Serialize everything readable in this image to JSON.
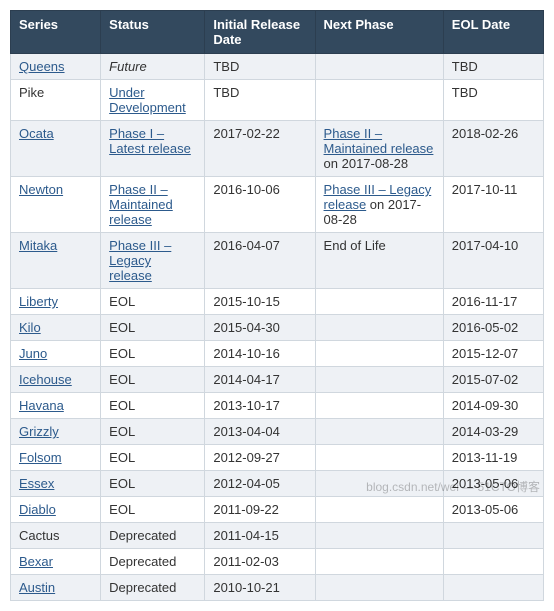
{
  "headers": {
    "series": "Series",
    "status": "Status",
    "initial": "Initial Release Date",
    "next": "Next Phase",
    "eol": "EOL Date"
  },
  "rows": [
    {
      "series": {
        "text": "Queens",
        "link": true
      },
      "status": {
        "text": "Future",
        "link": false,
        "italic": true
      },
      "initial": "TBD",
      "next": {
        "text": "",
        "link": "",
        "suffix": ""
      },
      "eol": "TBD"
    },
    {
      "series": {
        "text": "Pike",
        "link": false
      },
      "status": {
        "text": "Under Development",
        "link": true
      },
      "initial": "TBD",
      "next": {
        "text": "",
        "link": "",
        "suffix": ""
      },
      "eol": "TBD"
    },
    {
      "series": {
        "text": "Ocata",
        "link": true
      },
      "status": {
        "text": "Phase I – Latest release",
        "link": true
      },
      "initial": "2017-02-22",
      "next": {
        "link": "Phase II – Maintained release",
        "suffix": " on 2017-08-28"
      },
      "eol": "2018-02-26"
    },
    {
      "series": {
        "text": "Newton",
        "link": true
      },
      "status": {
        "text": "Phase II – Maintained release",
        "link": true
      },
      "initial": "2016-10-06",
      "next": {
        "link": "Phase III – Legacy release",
        "suffix": " on 2017-08-28"
      },
      "eol": "2017-10-11"
    },
    {
      "series": {
        "text": "Mitaka",
        "link": true
      },
      "status": {
        "text": "Phase III – Legacy release",
        "link": true
      },
      "initial": "2016-04-07",
      "next": {
        "text": "End of Life",
        "link": "",
        "suffix": ""
      },
      "eol": "2017-04-10"
    },
    {
      "series": {
        "text": "Liberty",
        "link": true
      },
      "status": {
        "text": "EOL",
        "link": false
      },
      "initial": "2015-10-15",
      "next": {
        "text": "",
        "link": "",
        "suffix": ""
      },
      "eol": "2016-11-17"
    },
    {
      "series": {
        "text": "Kilo",
        "link": true
      },
      "status": {
        "text": "EOL",
        "link": false
      },
      "initial": "2015-04-30",
      "next": {
        "text": "",
        "link": "",
        "suffix": ""
      },
      "eol": "2016-05-02"
    },
    {
      "series": {
        "text": "Juno",
        "link": true
      },
      "status": {
        "text": "EOL",
        "link": false
      },
      "initial": "2014-10-16",
      "next": {
        "text": "",
        "link": "",
        "suffix": ""
      },
      "eol": "2015-12-07"
    },
    {
      "series": {
        "text": "Icehouse",
        "link": true
      },
      "status": {
        "text": "EOL",
        "link": false
      },
      "initial": "2014-04-17",
      "next": {
        "text": "",
        "link": "",
        "suffix": ""
      },
      "eol": "2015-07-02"
    },
    {
      "series": {
        "text": "Havana",
        "link": true
      },
      "status": {
        "text": "EOL",
        "link": false
      },
      "initial": "2013-10-17",
      "next": {
        "text": "",
        "link": "",
        "suffix": ""
      },
      "eol": "2014-09-30"
    },
    {
      "series": {
        "text": "Grizzly",
        "link": true
      },
      "status": {
        "text": "EOL",
        "link": false
      },
      "initial": "2013-04-04",
      "next": {
        "text": "",
        "link": "",
        "suffix": ""
      },
      "eol": "2014-03-29"
    },
    {
      "series": {
        "text": "Folsom",
        "link": true
      },
      "status": {
        "text": "EOL",
        "link": false
      },
      "initial": "2012-09-27",
      "next": {
        "text": "",
        "link": "",
        "suffix": ""
      },
      "eol": "2013-11-19"
    },
    {
      "series": {
        "text": "Essex",
        "link": true
      },
      "status": {
        "text": "EOL",
        "link": false
      },
      "initial": "2012-04-05",
      "next": {
        "text": "",
        "link": "",
        "suffix": ""
      },
      "eol": "2013-05-06"
    },
    {
      "series": {
        "text": "Diablo",
        "link": true
      },
      "status": {
        "text": "EOL",
        "link": false
      },
      "initial": "2011-09-22",
      "next": {
        "text": "",
        "link": "",
        "suffix": ""
      },
      "eol": "2013-05-06"
    },
    {
      "series": {
        "text": "Cactus",
        "link": false
      },
      "status": {
        "text": "Deprecated",
        "link": false
      },
      "initial": "2011-04-15",
      "next": {
        "text": "",
        "link": "",
        "suffix": ""
      },
      "eol": ""
    },
    {
      "series": {
        "text": "Bexar",
        "link": true
      },
      "status": {
        "text": "Deprecated",
        "link": false
      },
      "initial": "2011-02-03",
      "next": {
        "text": "",
        "link": "",
        "suffix": ""
      },
      "eol": ""
    },
    {
      "series": {
        "text": "Austin",
        "link": true
      },
      "status": {
        "text": "Deprecated",
        "link": false
      },
      "initial": "2010-10-21",
      "next": {
        "text": "",
        "link": "",
        "suffix": ""
      },
      "eol": ""
    }
  ],
  "watermark": "blog.csdn.net/wei — 51CTO博客"
}
